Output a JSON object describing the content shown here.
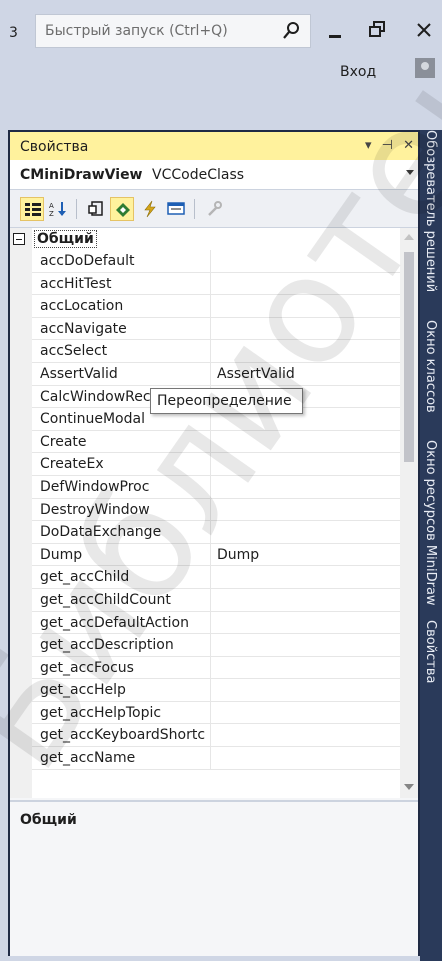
{
  "topbar": {
    "edge_label": "3",
    "quick_launch_placeholder": "Быстрый запуск (Ctrl+Q)",
    "login_label": "Вход"
  },
  "panel": {
    "title": "Свойства",
    "object_name": "CMiniDrawView",
    "object_class": "VCCodeClass"
  },
  "grid": {
    "category": "Общий",
    "rows": [
      {
        "name": "accDoDefault",
        "value": ""
      },
      {
        "name": "accHitTest",
        "value": ""
      },
      {
        "name": "accLocation",
        "value": ""
      },
      {
        "name": "accNavigate",
        "value": ""
      },
      {
        "name": "accSelect",
        "value": ""
      },
      {
        "name": "AssertValid",
        "value": "AssertValid"
      },
      {
        "name": "CalcWindowRect",
        "value": ""
      },
      {
        "name": "ContinueModal",
        "value": ""
      },
      {
        "name": "Create",
        "value": ""
      },
      {
        "name": "CreateEx",
        "value": ""
      },
      {
        "name": "DefWindowProc",
        "value": ""
      },
      {
        "name": "DestroyWindow",
        "value": ""
      },
      {
        "name": "DoDataExchange",
        "value": ""
      },
      {
        "name": "Dump",
        "value": "Dump"
      },
      {
        "name": "get_accChild",
        "value": ""
      },
      {
        "name": "get_accChildCount",
        "value": ""
      },
      {
        "name": "get_accDefaultAction",
        "value": ""
      },
      {
        "name": "get_accDescription",
        "value": ""
      },
      {
        "name": "get_accFocus",
        "value": ""
      },
      {
        "name": "get_accHelp",
        "value": ""
      },
      {
        "name": "get_accHelpTopic",
        "value": ""
      },
      {
        "name": "get_accKeyboardShortc",
        "value": ""
      },
      {
        "name": "get_accName",
        "value": ""
      }
    ]
  },
  "tooltip": "Переопределение",
  "description_title": "Общий",
  "vertical_tabs": [
    "Обозреватель решений",
    "Окно классов",
    "Окно ресурсов MiniDraw",
    "Свойства"
  ],
  "colors": {
    "title_active": "#fff29d",
    "frame": "#cfd6e5",
    "tab_strip": "#2a3a5a",
    "watermark": "#e8e8e8"
  },
  "watermark_text": "Библиотека Б"
}
